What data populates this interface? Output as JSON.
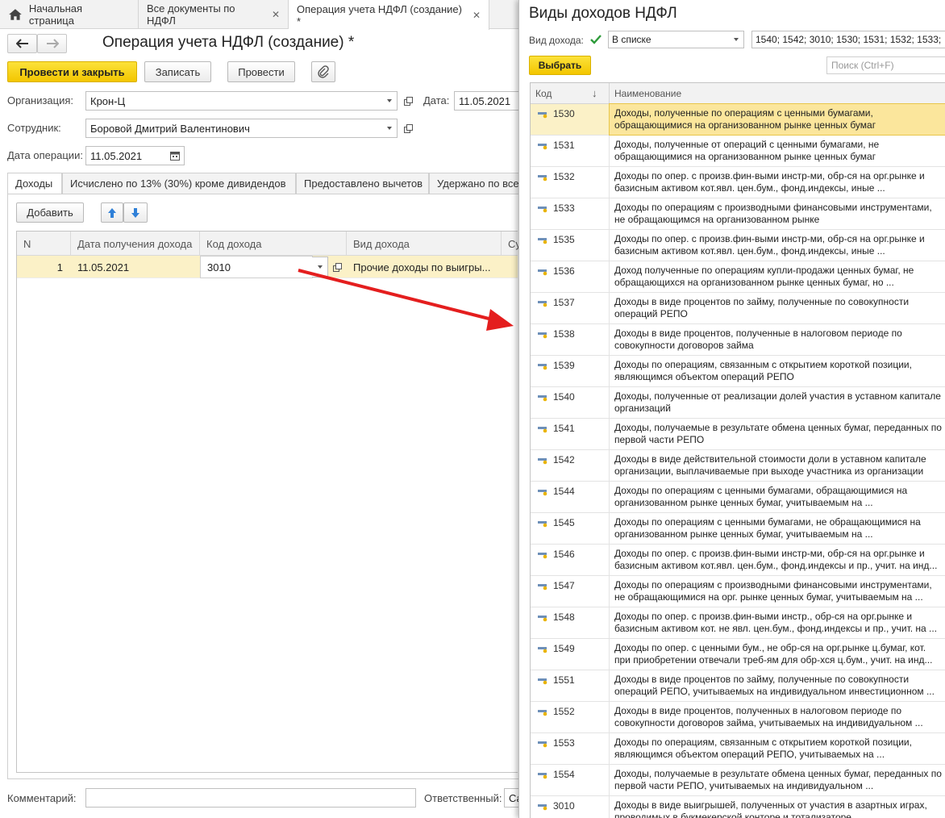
{
  "tabs": [
    {
      "label": "Начальная страница"
    },
    {
      "label": "Все документы по НДФЛ"
    },
    {
      "label": "Операция учета НДФЛ (создание) *"
    }
  ],
  "form": {
    "title": "Операция учета НДФЛ (создание) *",
    "buttons": {
      "post_close": "Провести и закрыть",
      "save": "Записать",
      "post": "Провести"
    },
    "org_label": "Организация:",
    "org_value": "Крон-Ц",
    "date_label": "Дата:",
    "date_value": "11.05.2021",
    "employee_label": "Сотрудник:",
    "employee_value": "Боровой Дмитрий Валентинович",
    "op_date_label": "Дата операции:",
    "op_date_value": "11.05.2021",
    "tabs": [
      "Доходы",
      "Исчислено по 13% (30%) кроме дивидендов",
      "Предоставлено вычетов",
      "Удержано по все"
    ],
    "add_button": "Добавить",
    "grid_headers": [
      "N",
      "Дата получения дохода",
      "Код дохода",
      "Вид дохода",
      "Су"
    ],
    "grid_rows": [
      {
        "n": "1",
        "date": "11.05.2021",
        "code": "3010",
        "kind": "Прочие доходы по выигры..."
      }
    ],
    "comment_label": "Комментарий:",
    "responsible_label": "Ответственный:",
    "responsible_value": "Са"
  },
  "panel": {
    "title": "Виды доходов НДФЛ",
    "filter_label": "Вид дохода:",
    "filter_mode": "В списке",
    "filter_value": "1540; 1542; 3010; 1530; 1531; 1532; 1533;",
    "select_button": "Выбрать",
    "search_placeholder": "Поиск (Ctrl+F)",
    "col_code": "Код",
    "col_name": "Наименование",
    "sort_indicator": "↓",
    "rows": [
      {
        "code": "1530",
        "name": "Доходы, полученные по операциям с ценными бумагами, обращающимися на организованном рынке ценных бумаг"
      },
      {
        "code": "1531",
        "name": "Доходы, полученные от операций с ценными бумагами, не обращающимися  на  организованном  рынке  ценных бумаг"
      },
      {
        "code": "1532",
        "name": "Доходы по опер. с произв.фин-выми инстр-ми, обр-ся на орг.рынке и базисным активом кот.явл. цен.бум., фонд.индексы, иные ..."
      },
      {
        "code": "1533",
        "name": "Доходы по операциям с производными финансовыми инструментами, не обращающимся на организованном рынке"
      },
      {
        "code": "1535",
        "name": "Доходы по опер. с произв.фин-выми инстр-ми, обр-ся на орг.рынке и базисным активом кот.явл. цен.бум., фонд.индексы, иные ..."
      },
      {
        "code": "1536",
        "name": "Доход полученные по операциям купли-продажи ценных бумаг, не обращающихся на организованном рынке ценных бумаг, но ..."
      },
      {
        "code": "1537",
        "name": "Доходы в виде процентов по займу, полученные по совокупности операций РЕПО"
      },
      {
        "code": "1538",
        "name": "Доходы в виде процентов, полученные в налоговом периоде по совокупности договоров займа"
      },
      {
        "code": "1539",
        "name": "Доходы по операциям, связанным с открытием короткой позиции, являющимся объектом операций РЕПО"
      },
      {
        "code": "1540",
        "name": "Доходы, полученные от реализации долей участия в уставном капитале организаций"
      },
      {
        "code": "1541",
        "name": "Доходы, получаемые в результате обмена ценных бумаг, переданных по первой части РЕПО"
      },
      {
        "code": "1542",
        "name": "Доходы в виде действительной стоимости доли в уставном капитале организации, выплачиваемые при выходе участника из организации"
      },
      {
        "code": "1544",
        "name": "Доходы по операциям с ценными бумагами, обращающимися на организованном рынке ценных бумаг, учитываемым на ..."
      },
      {
        "code": "1545",
        "name": "Доходы по операциям с ценными бумагами, не обращающимися на организованном рынке ценных бумаг, учитываемым на ..."
      },
      {
        "code": "1546",
        "name": "Доходы по опер. с произв.фин-выми инстр-ми, обр-ся на орг.рынке и базисным активом кот.явл. цен.бум., фонд.индексы и пр., учит. на инд..."
      },
      {
        "code": "1547",
        "name": "Доходы по операциям с производными финансовыми инструментами, не обращающимися на орг. рынке ценных бумаг, учитываемым на ..."
      },
      {
        "code": "1548",
        "name": "Доходы по опер. с произв.фин-выми инстр., обр-ся на орг.рынке и базисным активом кот. не явл. цен.бум., фонд.индексы и пр., учит. на ..."
      },
      {
        "code": "1549",
        "name": "Доходы по опер. с ценными бум., не обр-ся на орг.рынке ц.бумаг, кот. при приобретении отвечали треб-ям для обр-хся ц.бум., учит. на инд..."
      },
      {
        "code": "1551",
        "name": "Доходы в виде процентов по займу, полученные по совокупности операций РЕПО, учитываемых на индивидуальном инвестиционном ..."
      },
      {
        "code": "1552",
        "name": "Доходы в виде процентов, полученных в налоговом периоде по совокупности договоров займа, учитываемых на индивидуальном ..."
      },
      {
        "code": "1553",
        "name": "Доходы по операциям, связанным с открытием короткой позиции, являющимся объектом операций РЕПО, учитываемых на ..."
      },
      {
        "code": "1554",
        "name": "Доходы, получаемые в результате обмена ценных бумаг, переданных по первой части РЕПО, учитываемых на индивидуальном ..."
      },
      {
        "code": "3010",
        "name": "Доходы в виде выигрышей, полученных от участия в азартных играх, проводимых в букмекерской конторе и тотализаторе"
      }
    ]
  },
  "colors": {
    "accent_yellow": "#f5cd0f",
    "selected_row": "#fbe69c",
    "arrow": "#e41e1e"
  }
}
